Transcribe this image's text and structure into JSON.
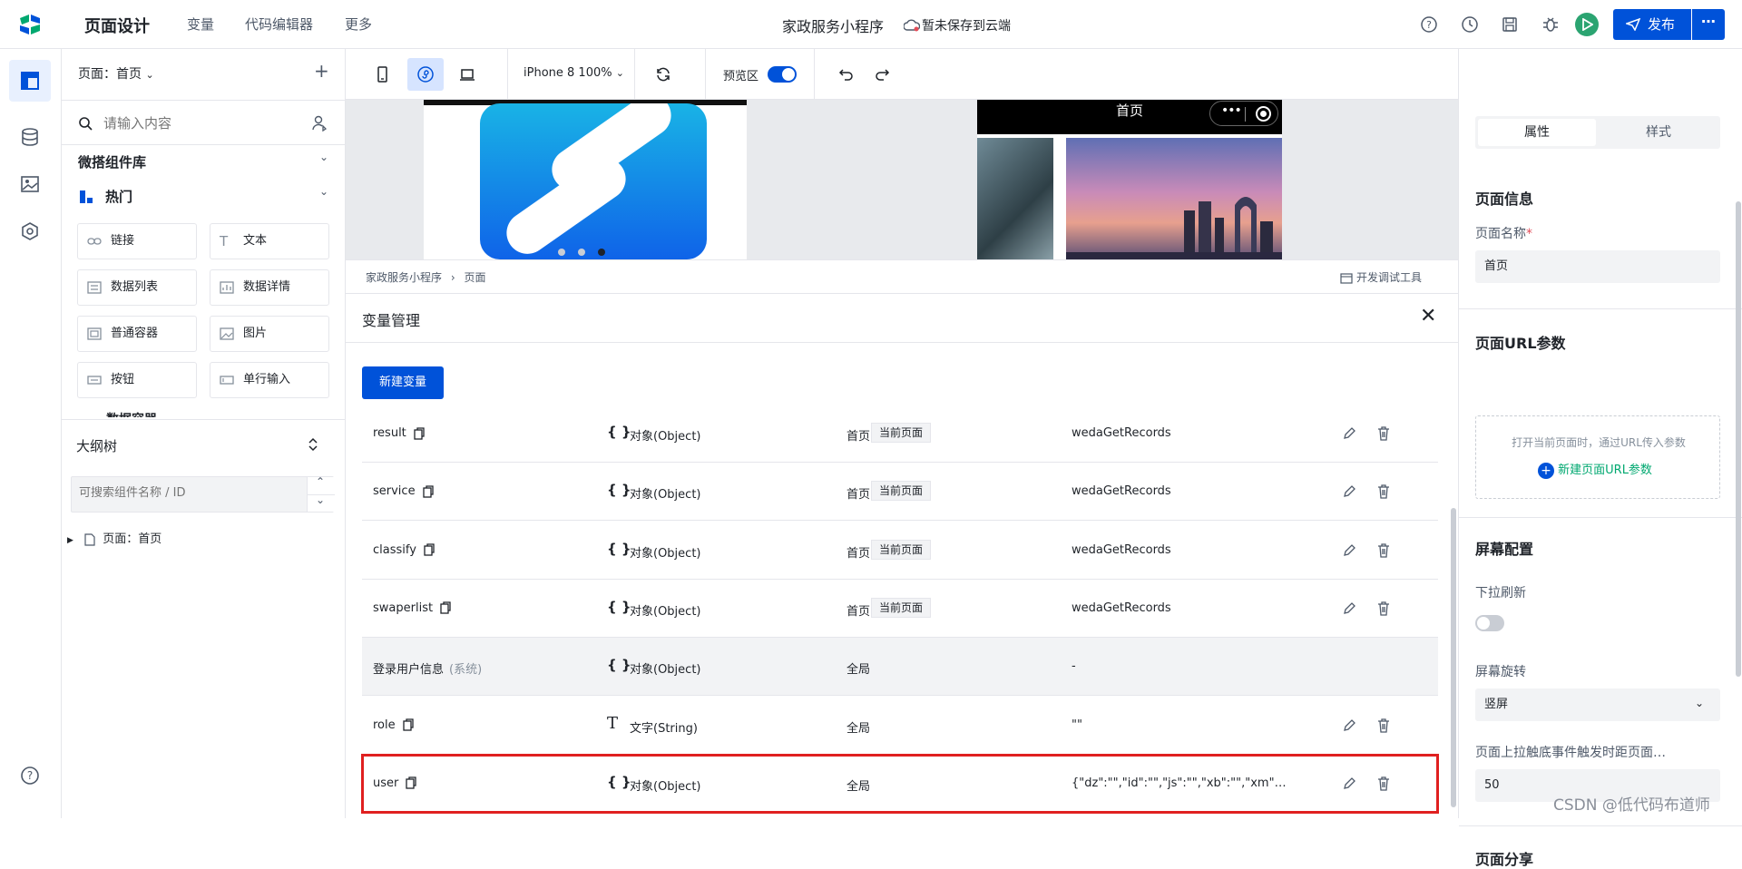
{
  "header": {
    "page_design": "页面设计",
    "nav": [
      "变量",
      "代码编辑器",
      "更多"
    ],
    "app_title": "家政服务小程序",
    "save_status": "暂未保存到云端",
    "publish_label": "发布"
  },
  "left_panel": {
    "page_selector": "页面：首页",
    "search_placeholder": "请输入内容",
    "library_title": "微搭组件库",
    "hot_title": "热门",
    "components": [
      "链接",
      "文本",
      "数据列表",
      "数据详情",
      "普通容器",
      "图片",
      "按钮",
      "单行输入"
    ],
    "partial_item": "数据容器",
    "outline_title": "大纲树",
    "outline_placeholder": "可搜索组件名称 / ID",
    "tree_item": "页面：首页"
  },
  "toolbar": {
    "device_label": "iPhone 8 100%",
    "preview_label": "预览区"
  },
  "preview": {
    "phone_title": "首页"
  },
  "dev_bar": {
    "breadcrumb": [
      "家政服务小程序",
      "页面"
    ],
    "breadcrumb_sep": "›",
    "tools_label": "开发调试工具"
  },
  "variable_panel": {
    "title": "变量管理",
    "new_variable": "新建变量",
    "rows": [
      {
        "name": "result",
        "type": "对象(Object)",
        "scope": "首页",
        "badge": "当前页面",
        "value": "wedaGetRecords"
      },
      {
        "name": "service",
        "type": "对象(Object)",
        "scope": "首页",
        "badge": "当前页面",
        "value": "wedaGetRecords"
      },
      {
        "name": "classify",
        "type": "对象(Object)",
        "scope": "首页",
        "badge": "当前页面",
        "value": "wedaGetRecords"
      },
      {
        "name": "swaperlist",
        "type": "对象(Object)",
        "scope": "首页",
        "badge": "当前页面",
        "value": "wedaGetRecords"
      },
      {
        "name": "登录用户信息",
        "tag": "(系统)",
        "type": "对象(Object)",
        "scope": "全局",
        "value": "-"
      },
      {
        "name": "role",
        "type": "文字(String)",
        "scope": "全局",
        "value": "\"\""
      },
      {
        "name": "user",
        "type": "对象(Object)",
        "scope": "全局",
        "value": "{\"dz\":\"\",\"id\":\"\",\"js\":\"\",\"xb\":\"\",\"xm\":\"\",\"ld..."
      }
    ]
  },
  "right_panel": {
    "tab_properties": "属性",
    "tab_style": "样式",
    "page_info_title": "页面信息",
    "page_name_label": "页面名称",
    "required_mark": "*",
    "page_name_value": "首页",
    "url_params_title": "页面URL参数",
    "url_hint": "打开当前页面时，通过URL传入参数",
    "url_add": "新建页面URL参数",
    "screen_config_title": "屏幕配置",
    "pull_refresh_label": "下拉刷新",
    "rotation_label": "屏幕旋转",
    "rotation_value": "竖屏",
    "reach_bottom_label": "页面上拉触底事件触发时距页面…",
    "reach_bottom_value": "50",
    "share_title": "页面分享"
  },
  "watermark": "CSDN @低代码布道师",
  "colors": {
    "primary": "#0052d9",
    "run": "#2ba471",
    "highlight": "#e02020"
  }
}
